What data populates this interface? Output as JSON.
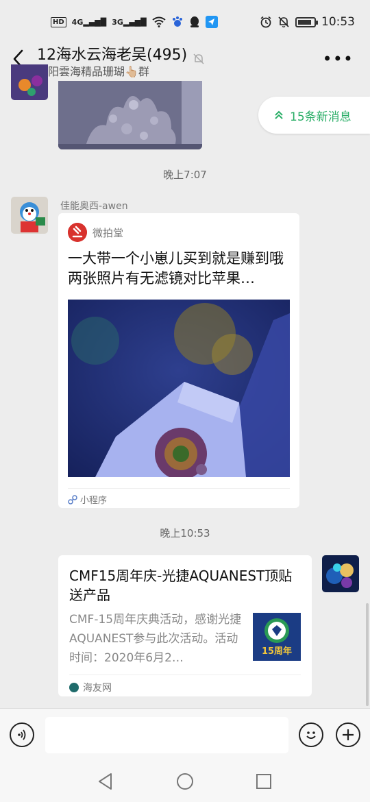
{
  "status_bar": {
    "hd_label": "HD",
    "signal1": "4G",
    "signal2": "3G",
    "time": "10:53",
    "battery_level": 0.85
  },
  "header": {
    "title": "12海水云海老吴(495)",
    "subtitle": "沈阳雲海精品珊瑚👆🏼群"
  },
  "new_messages": {
    "label": "15条新消息"
  },
  "timestamps": [
    "晚上7:07",
    "晚上10:53"
  ],
  "messages": [
    {
      "sender": "佳能奥西-awen",
      "mini_program": {
        "source": "微拍堂",
        "title": "一大带一个小崽儿买到就是赚到哦两张照片有无滤镜对比苹果…",
        "footer": "小程序"
      }
    },
    {
      "link_card": {
        "title": "CMF15周年庆-光捷AQUANEST顶贴送产品",
        "description": "CMF-15周年庆典活动，感谢光捷AQUANEST参与此次活动。活动时间：2020年6月2…",
        "site": "海友网"
      }
    }
  ],
  "input_bar": {
    "placeholder": ""
  },
  "colors": {
    "accent_green": "#2aae67",
    "chat_background": "#ededed"
  }
}
